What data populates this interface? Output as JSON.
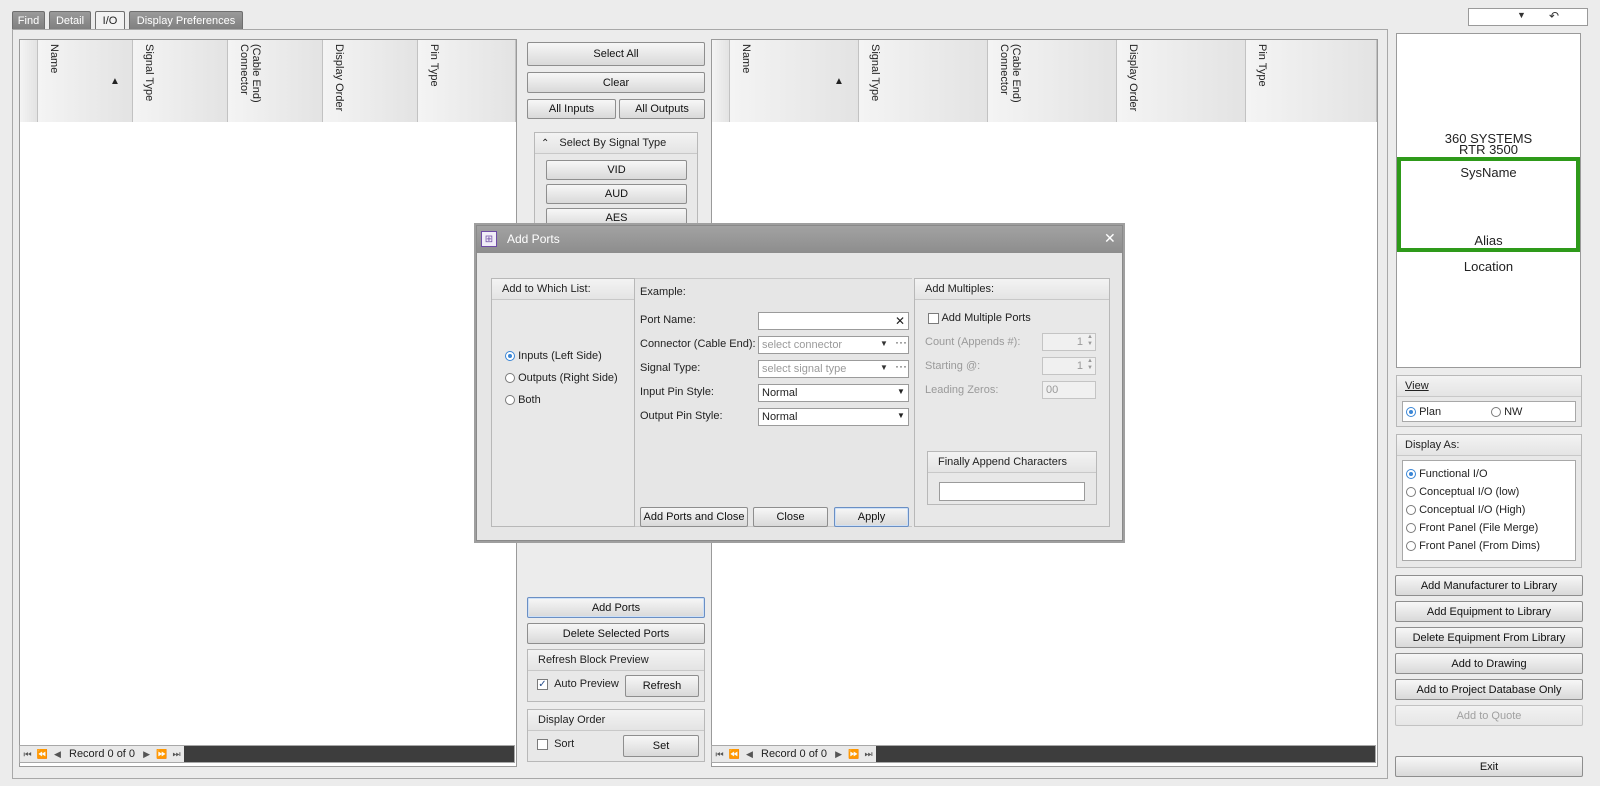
{
  "tabs": [
    "Find",
    "Detail",
    "I/O",
    "Display Preferences"
  ],
  "left_grid": {
    "columns": [
      "Name",
      "Signal Type",
      "(Cable End)\nConnector",
      "Display Order",
      "Pin Type"
    ],
    "sort_arrow": "▲",
    "nav_record": "Record 0 of 0"
  },
  "right_grid": {
    "columns": [
      "Name",
      "Signal Type",
      "(Cable End)\nConnector",
      "Display Order",
      "Pin Type"
    ],
    "sort_arrow": "▲",
    "nav_record": "Record 0 of 0"
  },
  "middle": {
    "select_all": "Select All",
    "clear": "Clear",
    "all_inputs": "All Inputs",
    "all_outputs": "All Outputs",
    "signal_group_title": "Select By Signal Type",
    "signal_types": [
      "VID",
      "AUD",
      "AES"
    ],
    "add_ports": "Add Ports",
    "delete_selected": "Delete Selected Ports",
    "refresh_group": "Refresh Block Preview",
    "auto_preview": "Auto Preview",
    "refresh": "Refresh",
    "display_order_group": "Display Order",
    "sort": "Sort",
    "set": "Set"
  },
  "preview": {
    "manufacturer": "360 SYSTEMS",
    "model": "RTR 3500",
    "sysname": "SysName",
    "alias": "Alias",
    "location": "Location",
    "accent": "#2e9a1a"
  },
  "view": {
    "title": "View",
    "options": [
      "Plan",
      "NW"
    ],
    "selected": "Plan"
  },
  "display_as": {
    "title": "Display As:",
    "options": [
      "Functional I/O",
      "Conceptual I/O (low)",
      "Conceptual I/O (High)",
      "Front Panel (File Merge)",
      "Front Panel (From Dims)"
    ],
    "selected": "Functional I/O"
  },
  "actions": [
    "Add Manufacturer to Library",
    "Add Equipment to Library",
    "Delete Equipment From Library",
    "Add to Drawing",
    "Add to Project Database Only",
    "Add to Quote"
  ],
  "exit": "Exit",
  "dialog": {
    "title": "Add Ports",
    "which_list": {
      "title": "Add to Which List:",
      "options": [
        "Inputs (Left Side)",
        "Outputs (Right Side)",
        "Both"
      ],
      "selected": "Inputs (Left Side)"
    },
    "example_label": "Example:",
    "port_name_label": "Port Name:",
    "port_name_value": "",
    "connector_label": "Connector (Cable End):",
    "connector_placeholder": "select connector",
    "signal_type_label": "Signal Type:",
    "signal_type_placeholder": "select signal type",
    "input_pin_label": "Input Pin Style:",
    "input_pin_value": "Normal",
    "output_pin_label": "Output Pin Style:",
    "output_pin_value": "Normal",
    "multiples": {
      "title": "Add Multiples:",
      "add_multiple": "Add Multiple Ports",
      "count_label": "Count (Appends #):",
      "count_value": "1",
      "starting_label": "Starting @:",
      "starting_value": "1",
      "leading_label": "Leading Zeros:",
      "leading_value": "00",
      "append_title": "Finally Append Characters",
      "append_value": ""
    },
    "btn_add_close": "Add Ports and Close",
    "btn_close": "Close",
    "btn_apply": "Apply"
  }
}
